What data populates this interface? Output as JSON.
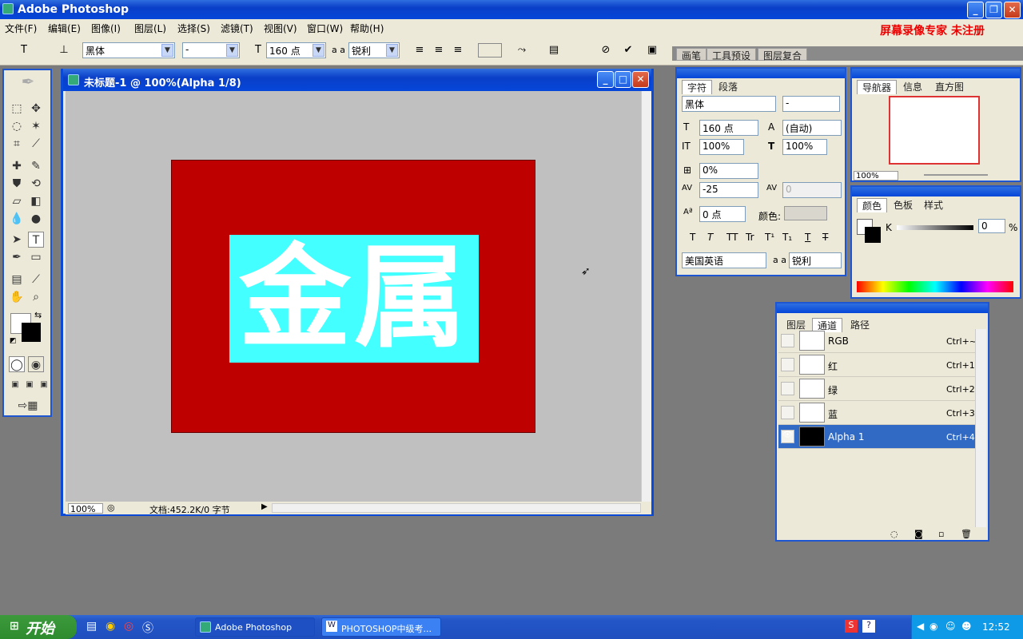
{
  "app": {
    "title": "Adobe Photoshop"
  },
  "watermark": "屏幕录像专家  未注册",
  "menu": [
    "文件(F)",
    "编辑(E)",
    "图像(I)",
    "图层(L)",
    "选择(S)",
    "滤镜(T)",
    "视图(V)",
    "窗口(W)",
    "帮助(H)"
  ],
  "options": {
    "font_family": "黑体",
    "font_style": "-",
    "font_size": "160 点",
    "aa_label": "a a",
    "antialias": "锐利"
  },
  "palette_well": [
    "画笔",
    "工具预设",
    "图层复合"
  ],
  "document": {
    "title": "未标题-1 @ 100%(Alpha 1/8)",
    "text": "金属",
    "zoom": "100%",
    "doc_info": "文档:452.2K/0 字节",
    "colors": {
      "background": "#bf0000",
      "selection": "#44ffff",
      "text": "#ffffff"
    }
  },
  "character_panel": {
    "tabs": [
      "字符",
      "段落"
    ],
    "font_family": "黑体",
    "font_style": "-",
    "size": "160 点",
    "leading": "(自动)",
    "vscale": "100%",
    "hscale": "100%",
    "baseline_shift_pct": "0%",
    "kerning": "-25",
    "tracking": "0",
    "baseline": "0 点",
    "color_label": "颜色:",
    "style_buttons": [
      "T",
      "T",
      "TT",
      "Tr",
      "T¹",
      "T₁",
      "T",
      "T"
    ],
    "language": "美国英语",
    "aa_label": "a a",
    "antialias": "锐利"
  },
  "navigator_panel": {
    "tabs": [
      "导航器",
      "信息",
      "直方图"
    ],
    "zoom": "100%"
  },
  "color_panel": {
    "tabs": [
      "颜色",
      "色板",
      "样式"
    ],
    "channel": "K",
    "value": "0",
    "unit": "%"
  },
  "channels_panel": {
    "tabs": [
      "图层",
      "通道",
      "路径"
    ],
    "rows": [
      {
        "name": "RGB",
        "shortcut": "Ctrl+~",
        "selected": false
      },
      {
        "name": "红",
        "shortcut": "Ctrl+1",
        "selected": false
      },
      {
        "name": "绿",
        "shortcut": "Ctrl+2",
        "selected": false
      },
      {
        "name": "蓝",
        "shortcut": "Ctrl+3",
        "selected": false
      },
      {
        "name": "Alpha 1",
        "shortcut": "Ctrl+4",
        "selected": true
      }
    ]
  },
  "taskbar": {
    "start": "开始",
    "tasks": [
      "Adobe Photoshop",
      "PHOTOSHOP中级考..."
    ],
    "clock": "12:52"
  }
}
